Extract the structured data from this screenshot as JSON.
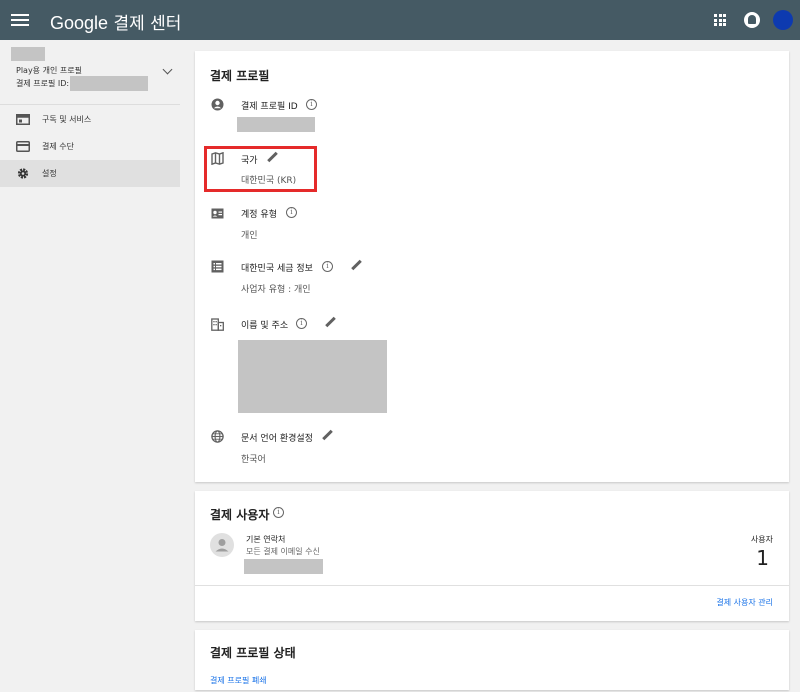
{
  "header": {
    "brand_google": "Google",
    "brand_product": "결제 센터"
  },
  "sidebar": {
    "profile_name": "Play용 개인 프로필",
    "profile_id_label": "결제 프로필 ID:",
    "items": [
      {
        "label": "구독 및 서비스",
        "icon": "calendar-icon"
      },
      {
        "label": "결제 수단",
        "icon": "credit-card-icon"
      },
      {
        "label": "설정",
        "icon": "gear-icon",
        "active": true
      }
    ]
  },
  "settings_card": {
    "title": "결제 프로필",
    "rows": {
      "profile_id": {
        "label": "결제 프로필 ID"
      },
      "country": {
        "label": "국가",
        "value": "대한민국 (KR)"
      },
      "account_type": {
        "label": "계정 유형",
        "value": "개인"
      },
      "tax_info": {
        "label": "대한민국 세금 정보",
        "value": "사업자 유형 : 개인"
      },
      "name_address": {
        "label": "이름 및 주소"
      },
      "doc_language": {
        "label": "문서 언어 환경설정",
        "value": "한국어"
      }
    }
  },
  "users_card": {
    "title": "결제 사용자",
    "contact_title": "기본 연락처",
    "contact_sub": "모든 결제 이메일 수신",
    "count_label": "사용자",
    "count_value": "1",
    "manage_link": "결제 사용자 관리"
  },
  "status_card": {
    "title": "결제 프로필 상태",
    "close_link": "결제 프로필 폐쇄"
  },
  "colors": {
    "topbar": "#455a64",
    "highlight": "#e52a2a",
    "link": "#1a73e8"
  }
}
